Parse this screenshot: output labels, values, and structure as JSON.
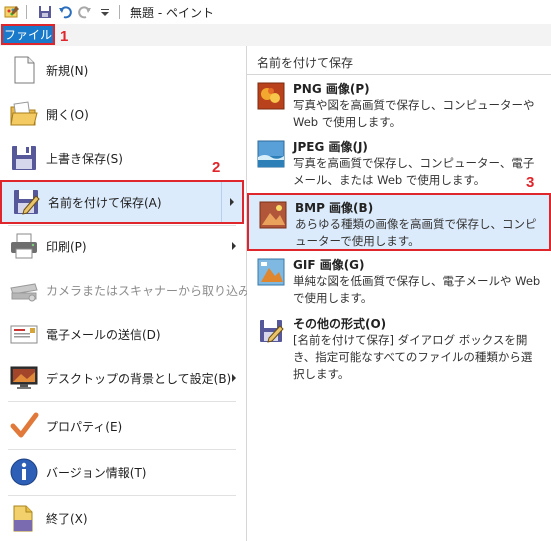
{
  "titlebar": {
    "title": "無題 - ペイント",
    "icons": [
      "paint-app-icon",
      "save-icon",
      "undo-icon",
      "redo-icon",
      "customize-qat-icon"
    ]
  },
  "ribbon": {
    "file_tab": "ファイル"
  },
  "annotations": {
    "step1": "1",
    "step2": "2",
    "step3": "3"
  },
  "left_menu": {
    "items": [
      {
        "label": "新規(N)",
        "icon": "new-document-icon"
      },
      {
        "label": "開く(O)",
        "icon": "open-folder-icon"
      },
      {
        "label": "上書き保存(S)",
        "icon": "save-disk-icon"
      },
      {
        "label": "名前を付けて保存(A)",
        "icon": "save-as-icon",
        "selected": true,
        "submenu": true
      },
      {
        "label": "印刷(P)",
        "icon": "printer-icon",
        "submenu": true
      },
      {
        "label": "カメラまたはスキャナーから取り込み(M)",
        "icon": "scanner-icon",
        "disabled": true
      },
      {
        "label": "電子メールの送信(D)",
        "icon": "email-icon"
      },
      {
        "label": "デスクトップの背景として設定(B)",
        "icon": "desktop-background-icon",
        "submenu": true
      },
      {
        "label": "プロパティ(E)",
        "icon": "properties-check-icon"
      },
      {
        "label": "バージョン情報(T)",
        "icon": "info-icon"
      },
      {
        "label": "終了(X)",
        "icon": "exit-icon"
      }
    ]
  },
  "right_panel": {
    "heading": "名前を付けて保存",
    "formats": [
      {
        "title": "PNG 画像(P)",
        "desc": "写真や図を高画質で保存し、コンピューターや Web で使用します。",
        "icon": "png-image-icon"
      },
      {
        "title": "JPEG 画像(J)",
        "desc": "写真を高画質で保存し、コンピューター、電子メール、または Web で使用します。",
        "icon": "jpeg-image-icon"
      },
      {
        "title": "BMP 画像(B)",
        "desc": "あらゆる種類の画像を高画質で保存し、コンピューターで使用します。",
        "icon": "bmp-image-icon",
        "selected": true
      },
      {
        "title": "GIF 画像(G)",
        "desc": "単純な図を低画質で保存し、電子メールや Web で使用します。",
        "icon": "gif-image-icon"
      },
      {
        "title": "その他の形式(O)",
        "desc": "[名前を付けて保存] ダイアログ ボックスを開き、指定可能なすべてのファイルの種類から選択します。",
        "icon": "other-formats-icon"
      }
    ]
  },
  "colors": {
    "accent": "#1979ca",
    "highlight": "#dcebfb",
    "annotation_red": "#e0262d"
  }
}
